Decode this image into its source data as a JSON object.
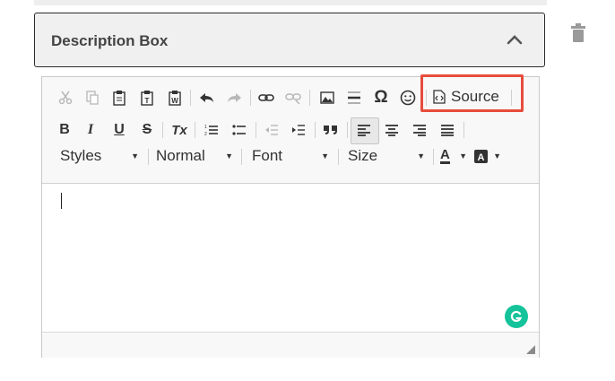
{
  "panel": {
    "title": "Description Box"
  },
  "editor": {
    "toolbar": {
      "row1": {
        "cut": "cut-icon",
        "copy": "copy-icon",
        "paste": "paste-icon",
        "paste_text": "paste-text-icon",
        "paste_word": "paste-word-icon",
        "undo": "undo-icon",
        "redo": "redo-icon",
        "link": "link-icon",
        "unlink": "unlink-icon",
        "image": "image-icon",
        "hr": "horizontal-line-icon",
        "special_char": "Ω",
        "smiley": "smiley-icon",
        "source_label": "Source"
      },
      "row2": {
        "bold": "B",
        "italic": "I",
        "underline": "U",
        "strike": "S",
        "remove_format": "Tx"
      },
      "row3": {
        "styles_label": "Styles",
        "format_label": "Normal",
        "font_label": "Font",
        "size_label": "Size",
        "text_color_label": "A"
      }
    },
    "content": ""
  },
  "colors": {
    "highlight": "#e74c3c",
    "grammarly": "#15c39a",
    "header_bg": "#f0f0f0"
  }
}
